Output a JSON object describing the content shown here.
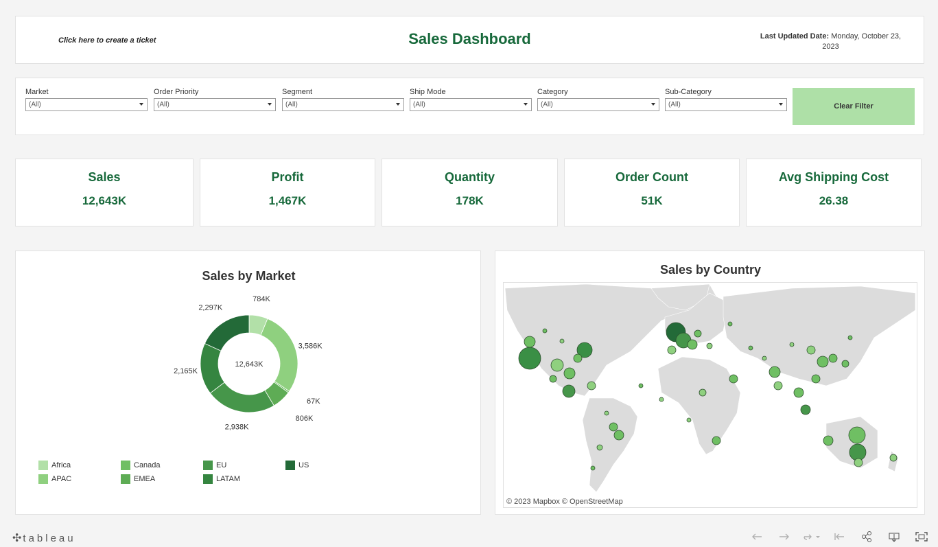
{
  "header": {
    "ticket_link": "Click here to create a ticket",
    "title": "Sales Dashboard",
    "updated_label": "Last Updated Date:",
    "updated_value": "Monday, October 23, 2023"
  },
  "filters": [
    {
      "label": "Market",
      "value": "(All)"
    },
    {
      "label": "Order Priority",
      "value": "(All)"
    },
    {
      "label": "Segment",
      "value": "(All)"
    },
    {
      "label": "Ship Mode",
      "value": "(All)"
    },
    {
      "label": "Category",
      "value": "(All)"
    },
    {
      "label": "Sub-Category",
      "value": "(All)"
    }
  ],
  "clear_filter_label": "Clear Filter",
  "kpis": [
    {
      "title": "Sales",
      "value": "12,643K"
    },
    {
      "title": "Profit",
      "value": "1,467K"
    },
    {
      "title": "Quantity",
      "value": "178K"
    },
    {
      "title": "Order Count",
      "value": "51K"
    },
    {
      "title": "Avg Shipping Cost",
      "value": "26.38"
    }
  ],
  "colors": {
    "accent": "#17693b",
    "clear_button": "#aee0a7",
    "panel_bg": "#ffffff",
    "page_bg": "#f4f4f4"
  },
  "market_chart": {
    "title": "Sales by Market",
    "center_label": "12,643K"
  },
  "chart_data": {
    "type": "pie",
    "title": "Sales by Market",
    "total": "12,643K",
    "series": [
      {
        "name": "Africa",
        "value": 784,
        "label": "784K",
        "color": "#b2e0a8"
      },
      {
        "name": "APAC",
        "value": 3586,
        "label": "3,586K",
        "color": "#8fd07f"
      },
      {
        "name": "Canada",
        "value": 67,
        "label": "67K",
        "color": "#6fbf63"
      },
      {
        "name": "EMEA",
        "value": 806,
        "label": "806K",
        "color": "#5eac55"
      },
      {
        "name": "EU",
        "value": 2938,
        "label": "2,938K",
        "color": "#46964a"
      },
      {
        "name": "LATAM",
        "value": 2165,
        "label": "2,165K",
        "color": "#358540"
      },
      {
        "name": "US",
        "value": 2297,
        "label": "2,297K",
        "color": "#236a38"
      }
    ],
    "legend_order": [
      "Africa",
      "APAC",
      "Canada",
      "EMEA",
      "EU",
      "LATAM",
      "US"
    ]
  },
  "country_map": {
    "title": "Sales by Country",
    "attribution": "© 2023 Mapbox  © OpenStreetMap"
  },
  "footer": {
    "logo_text": "tableau",
    "toolbar_icons": [
      "undo-icon",
      "redo-icon",
      "revert-icon",
      "reset-icon",
      "share-icon",
      "download-icon",
      "fullscreen-icon"
    ]
  }
}
